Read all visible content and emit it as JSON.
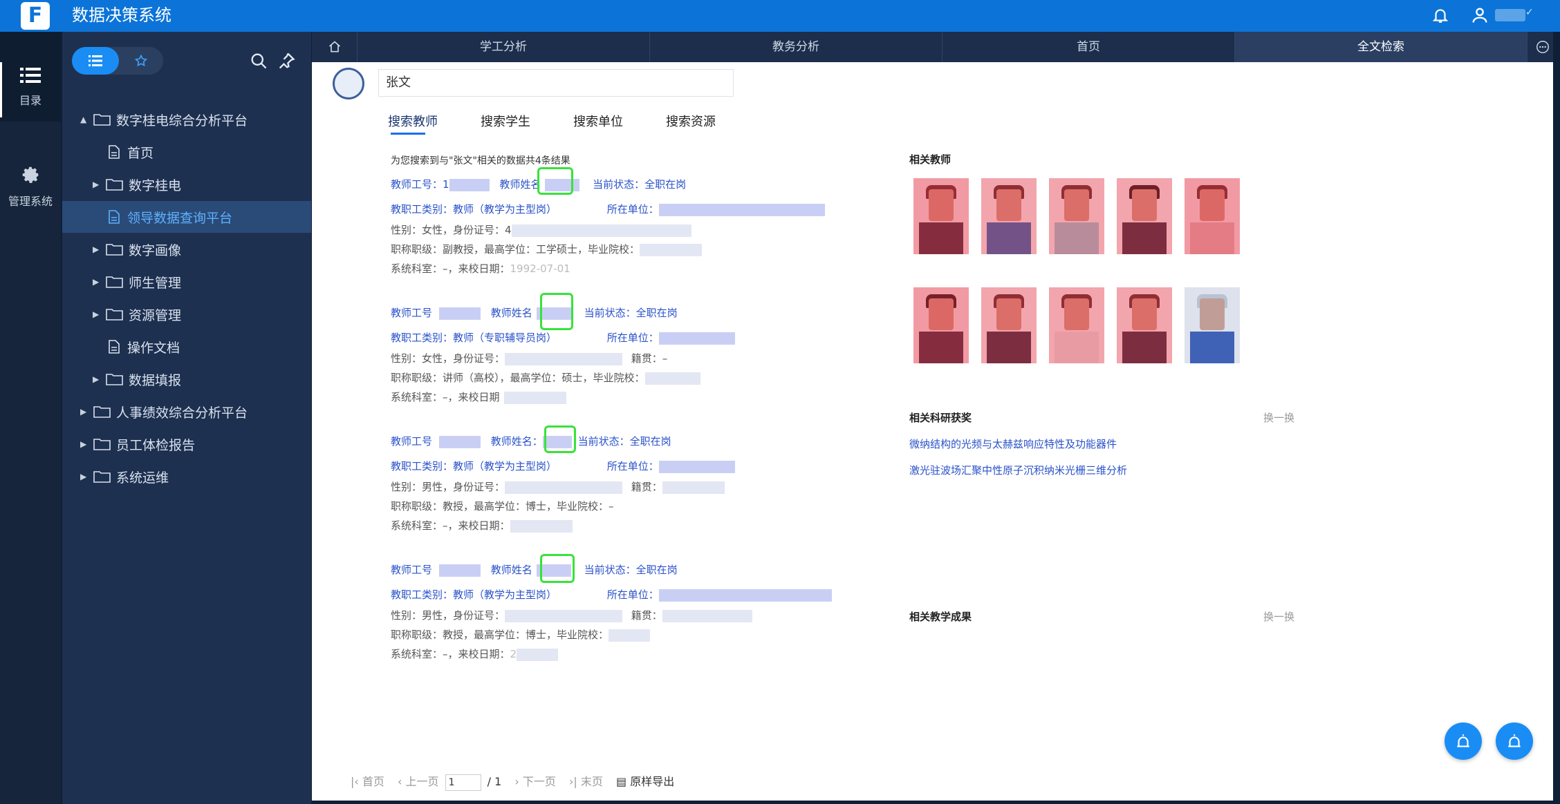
{
  "app": {
    "title": "数据决策系统",
    "logo_text": "F"
  },
  "rail": {
    "catalog_label": "目录",
    "admin_label": "管理系统"
  },
  "sidebar": {
    "tree": [
      {
        "label": "数字桂电综合分析平台",
        "level": 0,
        "type": "folder",
        "expanded": true
      },
      {
        "label": "首页",
        "level": 1,
        "type": "file"
      },
      {
        "label": "数字桂电",
        "level": 1,
        "type": "folder"
      },
      {
        "label": "领导数据查询平台",
        "level": 1,
        "type": "file",
        "active": true
      },
      {
        "label": "数字画像",
        "level": 1,
        "type": "folder"
      },
      {
        "label": "师生管理",
        "level": 1,
        "type": "folder"
      },
      {
        "label": "资源管理",
        "level": 1,
        "type": "folder"
      },
      {
        "label": "操作文档",
        "level": 1,
        "type": "file"
      },
      {
        "label": "数据填报",
        "level": 1,
        "type": "folder"
      },
      {
        "label": "人事绩效综合分析平台",
        "level": 0,
        "type": "folder"
      },
      {
        "label": "员工体检报告",
        "level": 0,
        "type": "folder"
      },
      {
        "label": "系统运维",
        "level": 0,
        "type": "folder"
      }
    ]
  },
  "tabs": [
    {
      "label": "学工分析"
    },
    {
      "label": "教务分析"
    },
    {
      "label": "首页"
    },
    {
      "label": "全文检索",
      "active": true
    }
  ],
  "search": {
    "value": "张文"
  },
  "search_tabs": [
    "搜索教师",
    "搜索学生",
    "搜索单位",
    "搜索资源"
  ],
  "summary": "为您搜索到与\"张文\"相关的数据共4条结果",
  "records": [
    {
      "id_label": "教师工号：",
      "id_value": "1",
      "name_label": "教师姓名",
      "status": "当前状态：全职在岗",
      "category": "教职工类别：教师（教学为主型岗）",
      "unit_label": "所在单位：",
      "gender_line": "性别：女性，身份证号：",
      "id_partial": "4",
      "title_line": "职称职级：副教授，最高学位：工学硕士，毕业院校：",
      "room_line": "系统科室：–，来校日期：",
      "date_partial": "1992-07-01"
    },
    {
      "id_label": "教师工号",
      "id_value": "",
      "name_label": "教师姓名",
      "status": "当前状态：全职在岗",
      "category": "教职工类别：教师（专职辅导员岗）",
      "unit_label": "所在单位：",
      "gender_line": "性别：女性，身份证号：",
      "native_label": "籍贯：–",
      "title_line": "职称职级：讲师（高校），最高学位：硕士，毕业院校：",
      "room_line": "系统科室：–，来校日期",
      "date_partial": ""
    },
    {
      "id_label": "教师工号",
      "id_value": "",
      "name_label": "教师姓名：",
      "status": "当前状态：全职在岗",
      "category": "教职工类别：教师（教学为主型岗）",
      "unit_label": "所在单位：",
      "gender_line": "性别：男性，身份证号：",
      "native_label": "籍贯：",
      "title_line": "职称职级：教授，最高学位：博士，毕业院校：–",
      "room_line": "系统科室：–，来校日期：",
      "date_partial": ""
    },
    {
      "id_label": "教师工号",
      "id_value": "",
      "name_label": "教师姓名",
      "status": "当前状态：全职在岗",
      "category": "教职工类别：教师（教学为主型岗）",
      "unit_label": "所在单位：",
      "gender_line": "性别：男性，身份证号：",
      "native_label": "籍贯：",
      "title_line": "职称职级：教授，最高学位：博士，毕业院校：",
      "room_line": "系统科室：–，来校日期：",
      "date_partial": "2"
    }
  ],
  "related_teachers": {
    "title": "相关教师"
  },
  "related_awards": {
    "title": "相关科研获奖",
    "swap": "换一换",
    "items": [
      "微纳结构的光频与太赫兹响应特性及功能器件",
      "激光驻波场汇聚中性原子沉积纳米光栅三维分析"
    ]
  },
  "related_teaching": {
    "title": "相关教学成果",
    "swap": "换一换"
  },
  "pager": {
    "first": "首页",
    "prev": "上一页",
    "page": "1",
    "total": "/ 1",
    "next": "下一页",
    "last": "末页",
    "export": "原样导出"
  },
  "colors": {
    "topbar": "#0c74d8",
    "sidebar": "#1e3050",
    "link": "#2a52c9",
    "highlight_box": "#39e23a",
    "fab": "#1a8df5"
  }
}
